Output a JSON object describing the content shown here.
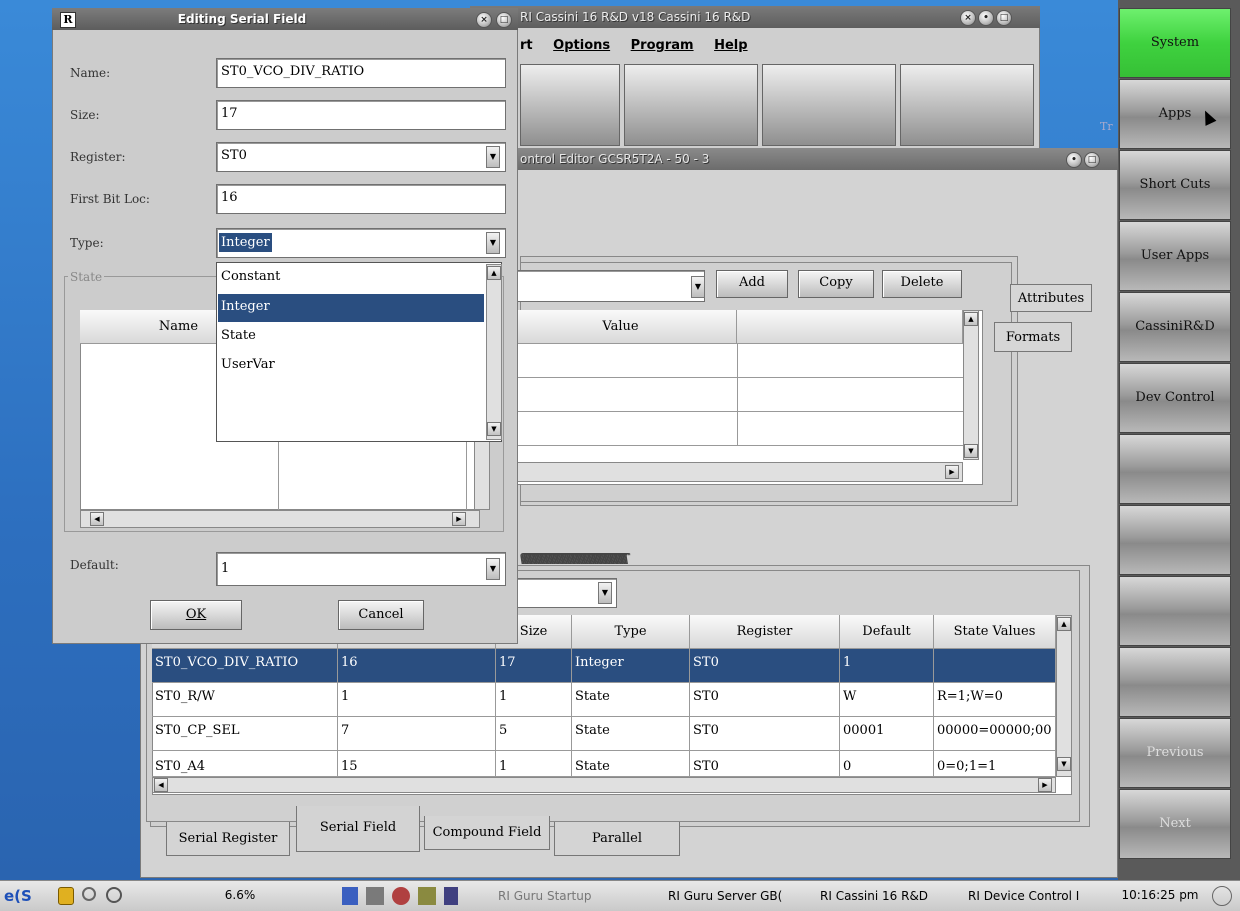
{
  "taskbar": {
    "cpu": "6.6%",
    "tasks": [
      "RI Guru Startup",
      "RI Guru Server GB(",
      "RI Cassini 16 R&D",
      "RI Device Control I"
    ],
    "clock": "10:16:25 pm"
  },
  "right_panel": {
    "buttons": [
      "System",
      "Apps",
      "Short Cuts",
      "User Apps",
      "CassiniR&D",
      "Dev Control",
      "",
      "",
      "",
      "",
      "Previous",
      "Next"
    ],
    "active_color": "#3fd23f"
  },
  "back_window": {
    "title": "RI Cassini 16 R&D v18  Cassini 16 R&D",
    "menu": [
      "rt",
      "Options",
      "Program",
      "Help"
    ],
    "side_text": "Tr"
  },
  "editor_window": {
    "title": "ontrol Editor GCSR5T2A - 50 - 3",
    "add": "Add",
    "copy": "Copy",
    "delete": "Delete",
    "tab_attributes": "Attributes",
    "tab_formats": "Formats",
    "value_header": "Value",
    "table": {
      "headers": [
        "",
        "Size",
        "Type",
        "Register",
        "Default",
        "State Values"
      ],
      "rows": [
        [
          "ST0_VCO_DIV_RATIO",
          "16",
          "17",
          "Integer",
          "ST0",
          "1",
          ""
        ],
        [
          "ST0_R/W",
          "1",
          "1",
          "State",
          "ST0",
          "W",
          "R=1;W=0"
        ],
        [
          "ST0_CP_SEL",
          "7",
          "5",
          "State",
          "ST0",
          "00001",
          "00000=00000;00"
        ],
        [
          "ST0_A4",
          "15",
          "1",
          "State",
          "ST0",
          "0",
          "0=0;1=1"
        ]
      ]
    },
    "bottom_tabs": [
      "Serial Register",
      "Serial Field",
      "Compound Field",
      "Parallel"
    ]
  },
  "dialog": {
    "title": "Editing Serial Field",
    "name_label": "Name:",
    "name_value": "ST0_VCO_DIV_RATIO",
    "size_label": "Size:",
    "size_value": "17",
    "register_label": "Register:",
    "register_value": "ST0",
    "firstbit_label": "First Bit Loc:",
    "firstbit_value": "16",
    "type_label": "Type:",
    "type_value": "Integer",
    "type_options": [
      "Constant",
      "Integer",
      "State",
      "UserVar"
    ],
    "state_label": "State",
    "state_col_name": "Name",
    "default_label": "Default:",
    "default_value": "1",
    "ok": "OK",
    "cancel": "Cancel"
  }
}
